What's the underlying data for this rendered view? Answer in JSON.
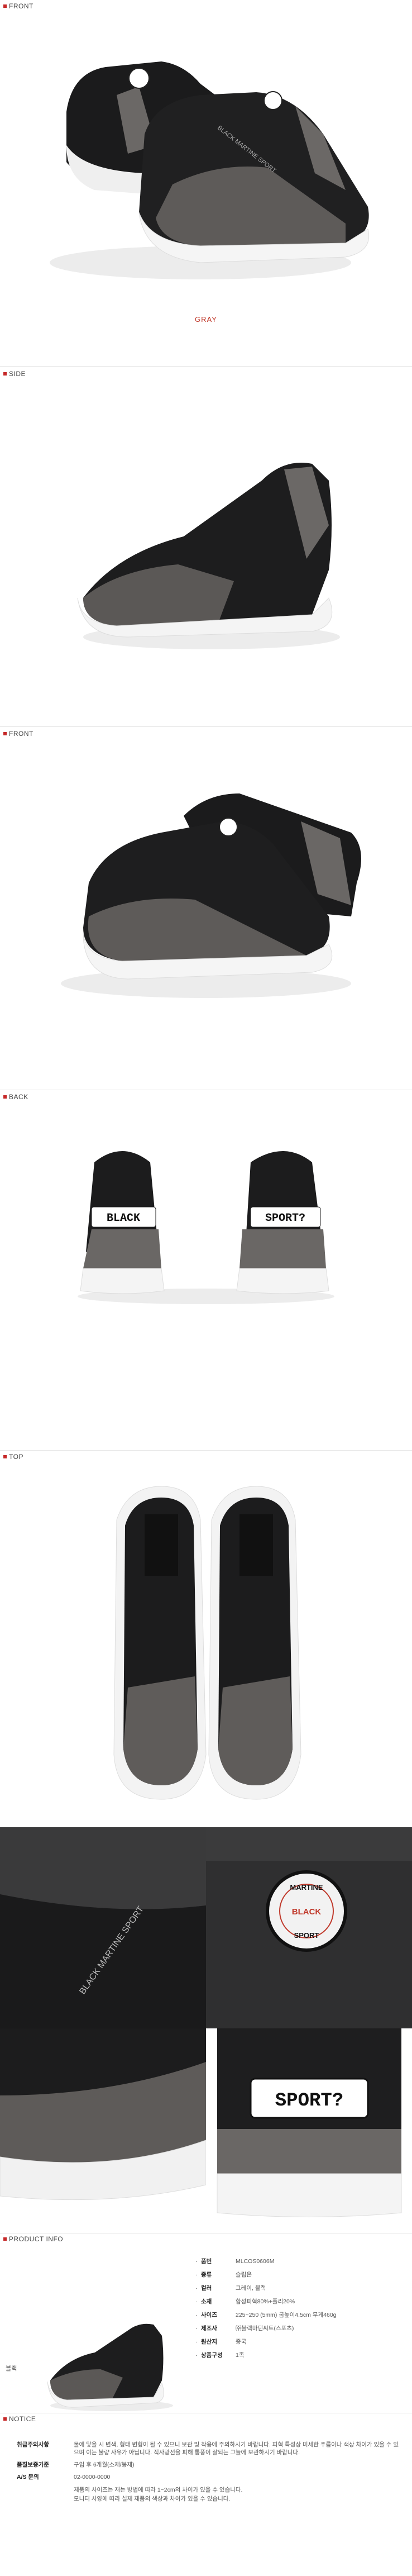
{
  "sections": {
    "front1": "FRONT",
    "side": "SIDE",
    "front2": "FRONT",
    "back": "BACK",
    "top": "TOP",
    "product_info": "PRODUCT INFO",
    "notice": "NOTICE"
  },
  "color_caption": "GRAY",
  "back_logos": {
    "left": "BLACK",
    "right": "SPORT?"
  },
  "detail_texts": {
    "side_print": "BLACK MARTINE SPORT",
    "badge_top": "MARTINE",
    "badge_bottom": "SPORT",
    "badge_mid": "BLACK",
    "heel_logo": "SPORT?"
  },
  "shoe_print": "BLACK MARTINE SPORT",
  "thumb_label": "블랙",
  "product_info": [
    {
      "k": "품번",
      "v": "MLCOS0606M"
    },
    {
      "k": "종류",
      "v": "슬립온"
    },
    {
      "k": "컬러",
      "v": "그레이, 블랙"
    },
    {
      "k": "소재",
      "v": "합성피혁80%+폴리20%"
    },
    {
      "k": "사이즈",
      "v": "225~250 (5mm) 굽높이4.5cm  무게460g"
    },
    {
      "k": "제조사",
      "v": "㈜블랙마틴씨트(스포츠)"
    },
    {
      "k": "원산지",
      "v": "중국"
    },
    {
      "k": "상품구성",
      "v": "1족"
    }
  ],
  "notice": [
    {
      "k": "취급주의사항",
      "v": "물에 닿을 시 변색, 형태 변형이 될 수 있으니 보관 및 착용에 주의하시기 바랍니다. 피혁 특성상 미세한 주름이나 색상 차이가 있을 수 있으며 이는 불량 사유가 아닙니다. 직사광선을 피해 통풍이 잘되는 그늘에 보관하시기 바랍니다."
    },
    {
      "k": "품질보증기준",
      "v": "구입 후 6개월(소재/봉제)"
    },
    {
      "k": "A/S 문의",
      "v": "02-0000-0000"
    }
  ],
  "notice_tail": [
    "제품의 사이즈는 재는 방법에 따라 1~2cm의 차이가 있을 수 있습니다.",
    "모니터 사양에 따라 실제 제품의 색상과 차이가 있을 수 있습니다."
  ],
  "colors": {
    "accent": "#c0392b",
    "upper": "#1b1b1c",
    "metal": "#6b6866",
    "sole": "#f3f3f3"
  }
}
